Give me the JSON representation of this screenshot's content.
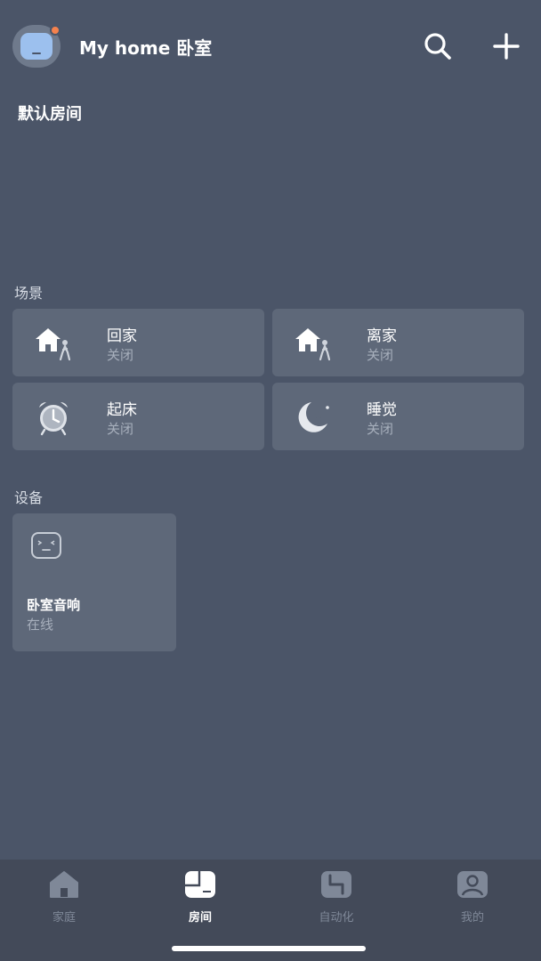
{
  "header": {
    "home_title": "My home 卧室",
    "search_icon": "search-icon",
    "add_icon": "plus-icon",
    "avatar_accent": "#f5824e"
  },
  "room": {
    "title": "默认房间"
  },
  "scenes": {
    "label": "场景",
    "items": [
      {
        "name": "回家",
        "status": "关闭",
        "icon": "home-arrive-icon"
      },
      {
        "name": "离家",
        "status": "关闭",
        "icon": "home-leave-icon"
      },
      {
        "name": "起床",
        "status": "关闭",
        "icon": "alarm-clock-icon"
      },
      {
        "name": "睡觉",
        "status": "关闭",
        "icon": "moon-icon"
      }
    ]
  },
  "devices": {
    "label": "设备",
    "items": [
      {
        "name": "卧室音响",
        "status": "在线",
        "icon": "speaker-icon"
      }
    ]
  },
  "bottom_nav": {
    "items": [
      {
        "label": "家庭",
        "icon": "home-icon",
        "active": false
      },
      {
        "label": "房间",
        "icon": "room-icon",
        "active": true
      },
      {
        "label": "自动化",
        "icon": "automation-icon",
        "active": false
      },
      {
        "label": "我的",
        "icon": "profile-icon",
        "active": false
      }
    ]
  },
  "colors": {
    "background": "#4b5568",
    "card": "#5e6879",
    "nav_bar": "#434a59",
    "muted_text": "#a7afbc",
    "accent_dot": "#f5824e"
  }
}
